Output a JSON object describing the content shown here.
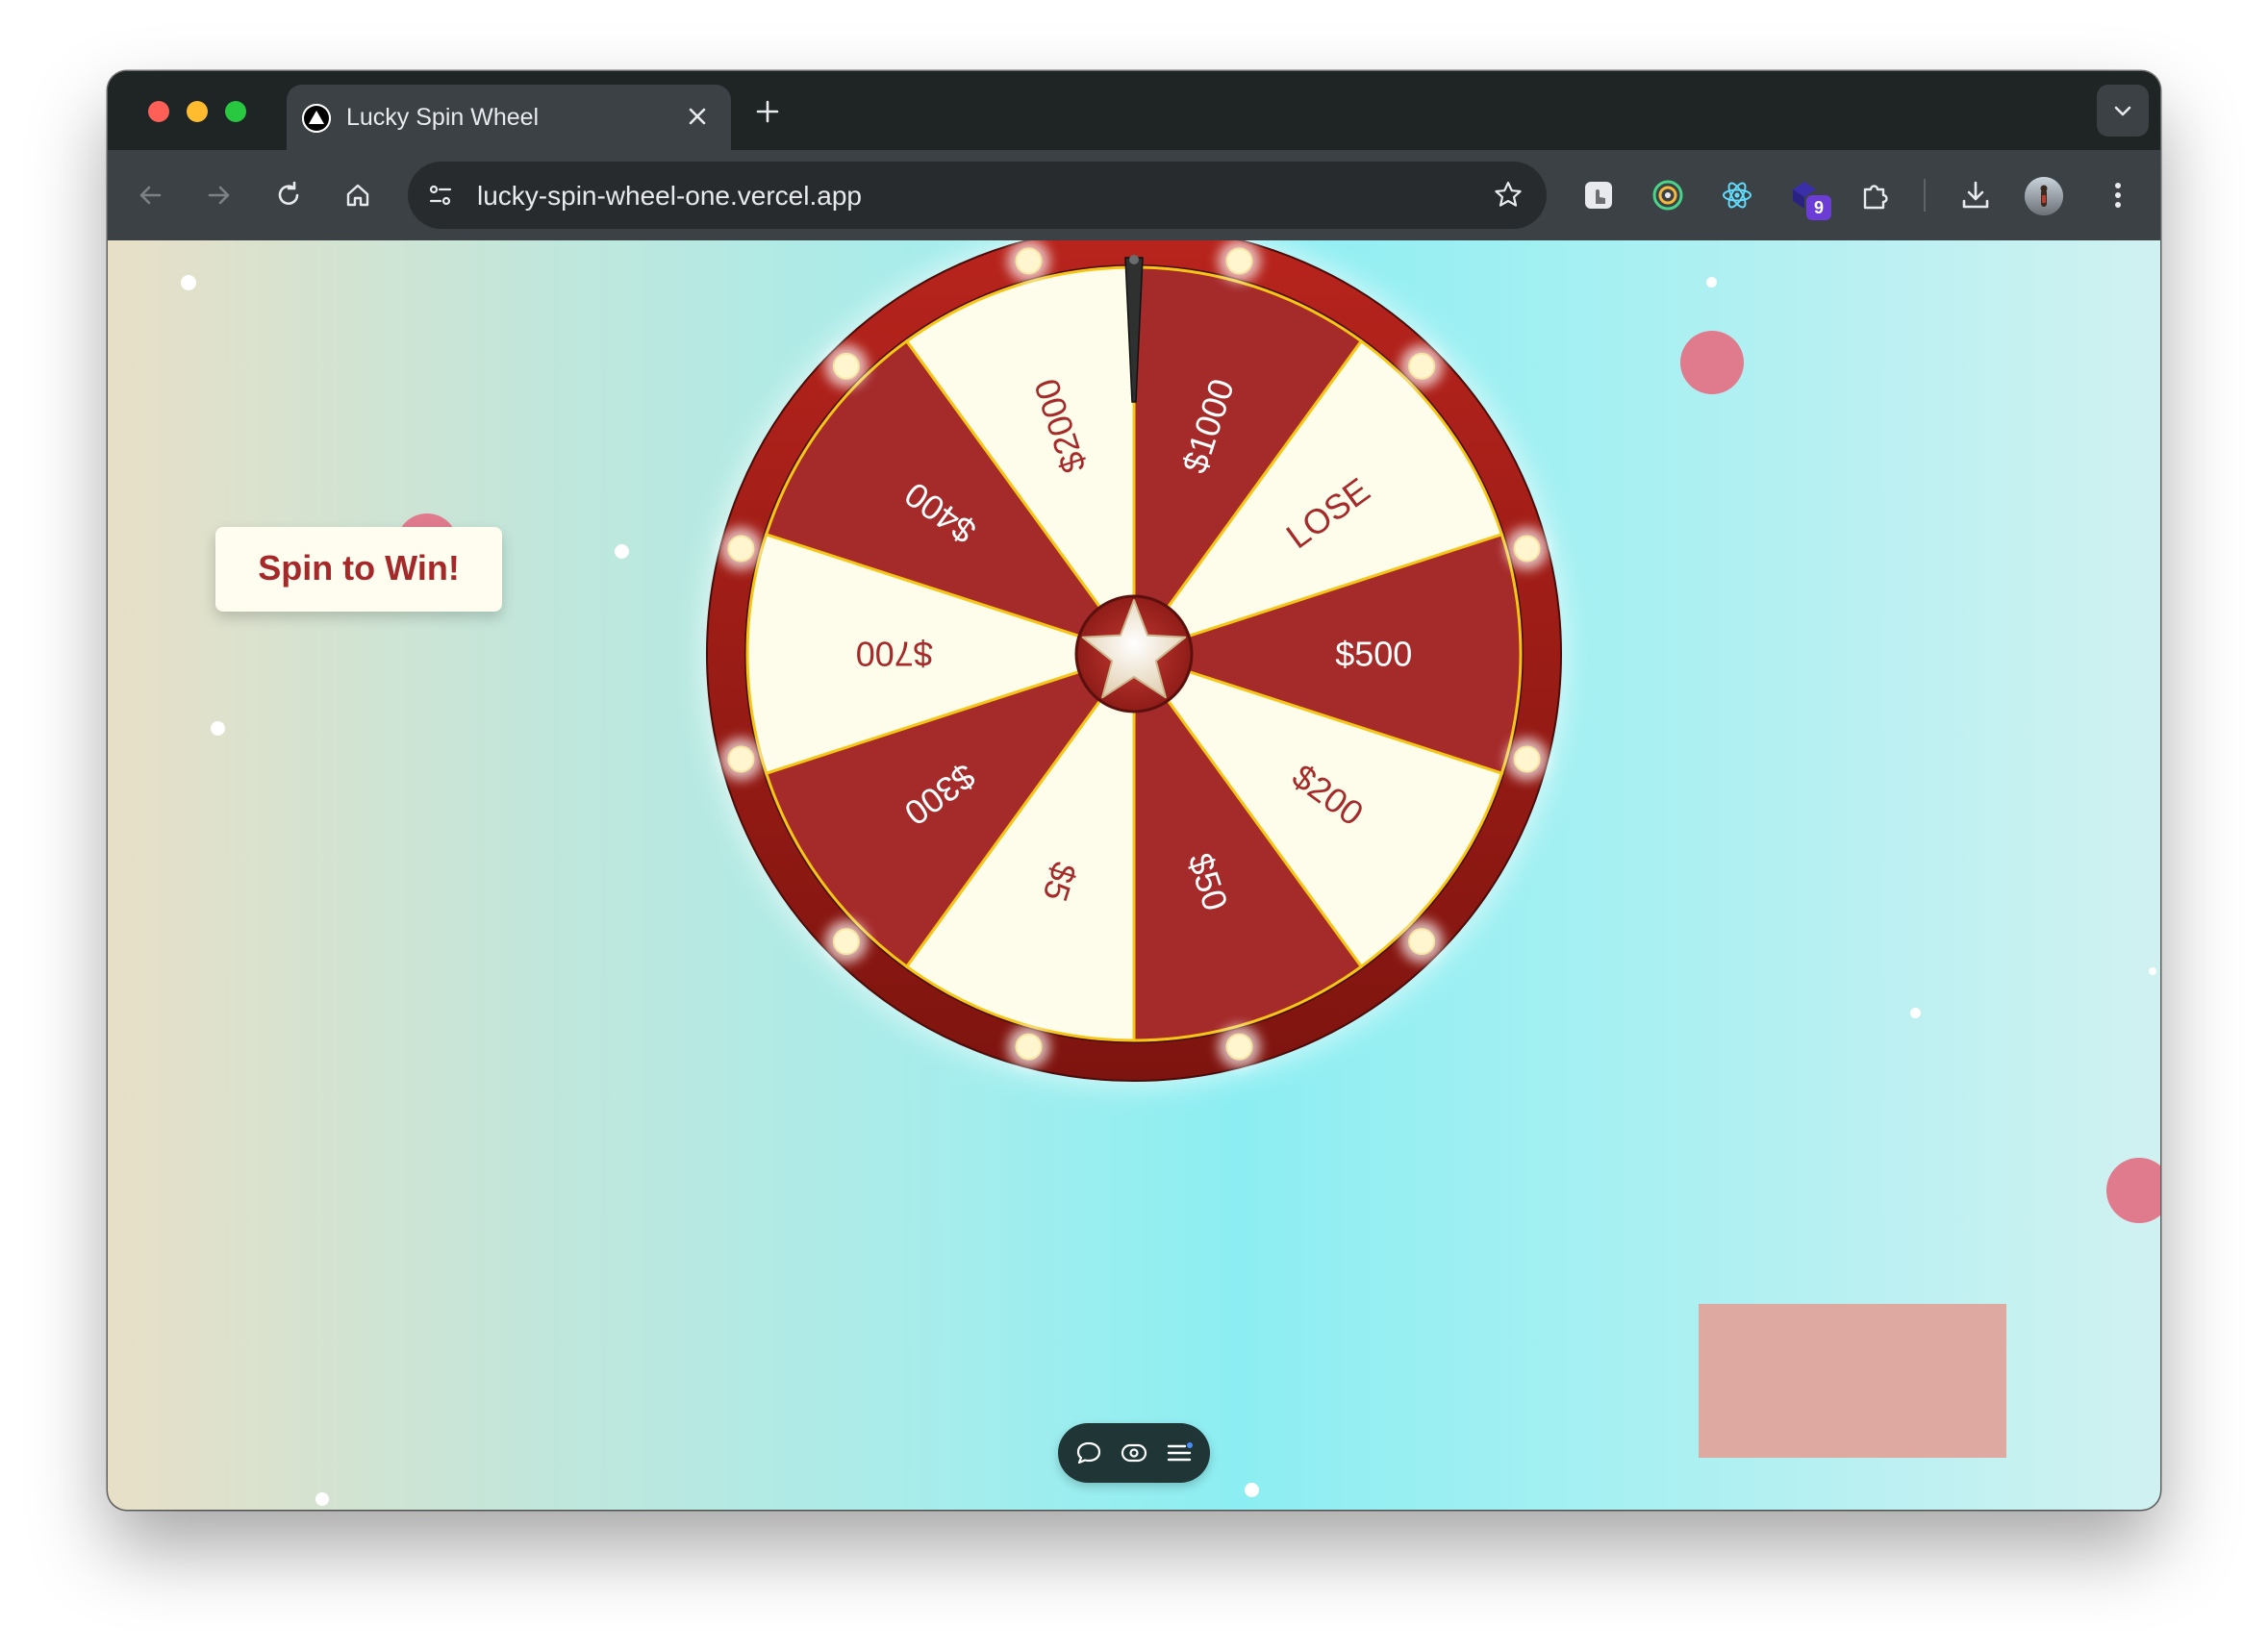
{
  "browser": {
    "tab_title": "Lucky Spin Wheel",
    "url": "lucky-spin-wheel-one.vercel.app",
    "extension_badge": "9"
  },
  "page": {
    "spin_button_label": "Spin to Win!",
    "wheel": {
      "segments": [
        {
          "label": "$1000",
          "color": "#a52a2a",
          "text_color": "#ffffff"
        },
        {
          "label": "LOSE",
          "color": "#fefdec",
          "text_color": "#a52a2a"
        },
        {
          "label": "$500",
          "color": "#a52a2a",
          "text_color": "#ffffff"
        },
        {
          "label": "$200",
          "color": "#fefdec",
          "text_color": "#a52a2a"
        },
        {
          "label": "$50",
          "color": "#a52a2a",
          "text_color": "#ffffff"
        },
        {
          "label": "$5",
          "color": "#fefdec",
          "text_color": "#a52a2a"
        },
        {
          "label": "$300",
          "color": "#a52a2a",
          "text_color": "#ffffff"
        },
        {
          "label": "$700",
          "color": "#fefdec",
          "text_color": "#a52a2a"
        },
        {
          "label": "$400",
          "color": "#a52a2a",
          "text_color": "#ffffff"
        },
        {
          "label": "$2000",
          "color": "#fefdec",
          "text_color": "#a52a2a"
        }
      ],
      "rim_color": "#a3201c",
      "divider_color": "#f5c518",
      "light_count": 12
    }
  },
  "colors": {
    "brand_red": "#a6292a",
    "bubble_pink": "#e07b8e"
  }
}
